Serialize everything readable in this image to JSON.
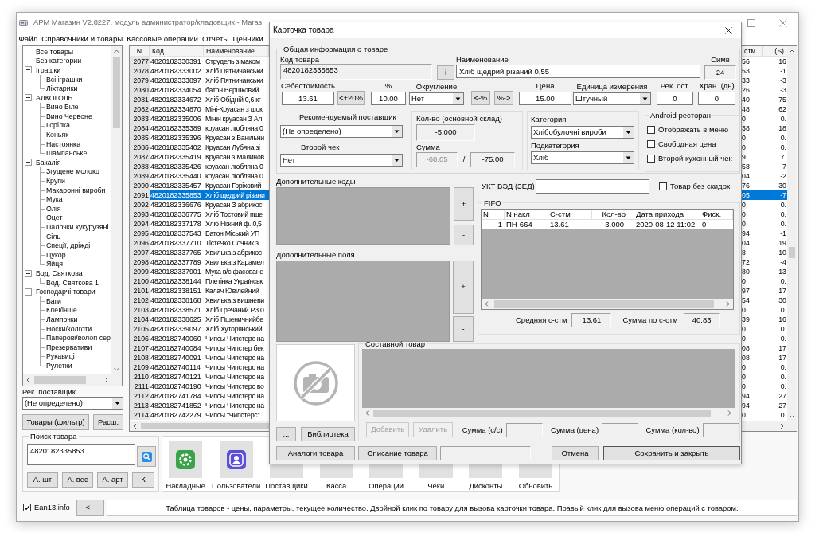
{
  "window": {
    "title": "АРМ Магазин V2.8227, модуль администратор/кладовщик - Магаз"
  },
  "menu": [
    "Файл",
    "Справочники и товары",
    "Кассовые операции",
    "Отчеты",
    "Ценники"
  ],
  "category_tree": [
    {
      "label": "Все товары"
    },
    {
      "label": "Без категории"
    },
    {
      "label": "Іграшки",
      "expanded": true,
      "children": [
        {
          "label": "Всі іграшки"
        },
        {
          "label": "Ліхтарики"
        }
      ]
    },
    {
      "label": "АЛКОГОЛЬ",
      "expanded": true,
      "children": [
        {
          "label": "Вино Біле"
        },
        {
          "label": "Вино Червоне"
        },
        {
          "label": "Горілка"
        },
        {
          "label": "Коньяк"
        },
        {
          "label": "Настоянка"
        },
        {
          "label": "Шампанське"
        }
      ]
    },
    {
      "label": "Бакалія",
      "expanded": true,
      "children": [
        {
          "label": "Згущене молоко"
        },
        {
          "label": "Крупи"
        },
        {
          "label": "Макаронні вироби"
        },
        {
          "label": "Мука"
        },
        {
          "label": "Олія"
        },
        {
          "label": "Оцет"
        },
        {
          "label": "Палочки кукурузяні"
        },
        {
          "label": "Сіль"
        },
        {
          "label": "Спеції, дріжді"
        },
        {
          "label": "Цукор"
        },
        {
          "label": "Яйця"
        }
      ]
    },
    {
      "label": "Вод. Святкова",
      "expanded": true,
      "children": [
        {
          "label": "Вод. Святкова 1"
        }
      ]
    },
    {
      "label": "Господарчі товари",
      "expanded": true,
      "children": [
        {
          "label": "Ваги"
        },
        {
          "label": "Клеї/інше"
        },
        {
          "label": "Лампочки"
        },
        {
          "label": "Носки/колготи"
        },
        {
          "label": "Паперові/вологі сер"
        },
        {
          "label": "Презервативи"
        },
        {
          "label": "Рукавиці"
        },
        {
          "label": "Рулетки"
        }
      ]
    }
  ],
  "supplier_filter": {
    "label": "Рек. поставщик",
    "value": "(Не определено)"
  },
  "filter_buttons": [
    "Товары (фильтр)",
    "Расш."
  ],
  "products_table": {
    "columns": [
      "N",
      "Код",
      "Наименование",
      "стм",
      "(S)"
    ],
    "rows": [
      {
        "cells": [
          "2077",
          "4820182330391",
          "Струдель з маком",
          "56",
          "16"
        ],
        "selected": false
      },
      {
        "cells": [
          "2078",
          "4820182333002",
          "Хліб Пятничанськи",
          "53",
          "-1"
        ],
        "selected": false
      },
      {
        "cells": [
          "2079",
          "4820182333897",
          "Хліб Пятничанськи",
          "33",
          "-3"
        ],
        "selected": false
      },
      {
        "cells": [
          "2080",
          "4820182334054",
          "батон Вершковий",
          "26",
          "-3"
        ],
        "selected": false
      },
      {
        "cells": [
          "2081",
          "4820182334672",
          "Хліб Обідній 0,6 кг",
          "40",
          "75"
        ],
        "selected": false
      },
      {
        "cells": [
          "2082",
          "4820182334870",
          "Міні-Круасан з шок",
          "48",
          "62"
        ],
        "selected": false
      },
      {
        "cells": [
          "2083",
          "4820182335006",
          "Мінін круасан З Ал",
          "0",
          "0."
        ],
        "selected": false
      },
      {
        "cells": [
          "2084",
          "4820182335389",
          "круасан любляна 0",
          "38",
          "18"
        ],
        "selected": false
      },
      {
        "cells": [
          "2085",
          "4820182335396",
          "Круасан з Ванільни",
          "0",
          "0."
        ],
        "selected": false
      },
      {
        "cells": [
          "2086",
          "4820182335402",
          "Круасан Лубяна зі",
          "0",
          "0."
        ],
        "selected": false
      },
      {
        "cells": [
          "2087",
          "4820182335419",
          "Круасан з Малинов",
          "9",
          "7."
        ],
        "selected": false
      },
      {
        "cells": [
          "2088",
          "4820182335426",
          "круасан любляна 0",
          "58",
          "-7"
        ],
        "selected": false
      },
      {
        "cells": [
          "2089",
          "4820182335440",
          "круасан любляна 0",
          "04",
          "-2"
        ],
        "selected": false
      },
      {
        "cells": [
          "2090",
          "4820182335457",
          "Круасан Горіховий",
          "76",
          "30"
        ],
        "selected": false
      },
      {
        "cells": [
          "2091",
          "4820182335853",
          "Хліб щедрий різани",
          "05",
          "-7"
        ],
        "selected": true
      },
      {
        "cells": [
          "2092",
          "4820182336676",
          "Круасан З абрикос",
          "0",
          "0."
        ],
        "selected": false
      },
      {
        "cells": [
          "2093",
          "4820182336775",
          "Хліб Тостовий пше",
          "0",
          "0."
        ],
        "selected": false
      },
      {
        "cells": [
          "2094",
          "4820182337178",
          "Хліб Ніжний ф. 0,5",
          "0",
          "0."
        ],
        "selected": false
      },
      {
        "cells": [
          "2095",
          "4820182337543",
          "Батон Міський УП",
          "94",
          "-1"
        ],
        "selected": false
      },
      {
        "cells": [
          "2096",
          "4820182337710",
          "Тістечко Сочник з",
          "04",
          "19"
        ],
        "selected": false
      },
      {
        "cells": [
          "2097",
          "4820182337765",
          "Хвилька з абрикос",
          "8",
          "10"
        ],
        "selected": false
      },
      {
        "cells": [
          "2098",
          "4820182337789",
          "Хвилька з Карамел",
          "72",
          "-4"
        ],
        "selected": false
      },
      {
        "cells": [
          "2099",
          "4820182337901",
          "Мука в/с фасоване",
          "80",
          "13"
        ],
        "selected": false
      },
      {
        "cells": [
          "2100",
          "4820182338144",
          "Плетінка Українськ",
          "0",
          "0."
        ],
        "selected": false
      },
      {
        "cells": [
          "2101",
          "4820182338151",
          "Калач Ювілейний",
          "97",
          "17"
        ],
        "selected": false
      },
      {
        "cells": [
          "2102",
          "4820182338168",
          "Хвилька з вишневи",
          "54",
          "30"
        ],
        "selected": false
      },
      {
        "cells": [
          "2103",
          "4820182338571",
          "Хліб Гречаний Р3 0",
          "0",
          "0."
        ],
        "selected": false
      },
      {
        "cells": [
          "2104",
          "4820182338625",
          "Хліб Пшеничнийбе",
          "39",
          "16"
        ],
        "selected": false
      },
      {
        "cells": [
          "2105",
          "4820182339097",
          "Хліб Хуторянський",
          "0",
          "0."
        ],
        "selected": false
      },
      {
        "cells": [
          "2106",
          "4820182740060",
          "Чипсы Чипстерс на",
          "0",
          "0."
        ],
        "selected": false
      },
      {
        "cells": [
          "2107",
          "4820182740084",
          "Чипсы Чипстер бек",
          "08",
          "17"
        ],
        "selected": false
      },
      {
        "cells": [
          "2108",
          "4820182740091",
          "Чипсы Чипстерс на",
          "08",
          "17"
        ],
        "selected": false
      },
      {
        "cells": [
          "2109",
          "4820182740114",
          "Чипсы Чипстерс на",
          "0",
          "0."
        ],
        "selected": false
      },
      {
        "cells": [
          "2110",
          "4820182740121",
          "Чипсы Чипстерс на",
          "0",
          "0."
        ],
        "selected": false
      },
      {
        "cells": [
          "2111",
          "4820182740190",
          "Чипсы Чипстерс во",
          "0",
          "0."
        ],
        "selected": false
      },
      {
        "cells": [
          "2112",
          "4820182741784",
          "Чипсы Чипстерс на",
          "94",
          "27"
        ],
        "selected": false
      },
      {
        "cells": [
          "2113",
          "4820182741852",
          "Чипсы Чипстерс на",
          "94",
          "27"
        ],
        "selected": false
      },
      {
        "cells": [
          "2114",
          "4820182742279",
          "Чипсы \"Чипстерс\"",
          "0",
          "0."
        ],
        "selected": false
      }
    ]
  },
  "product_search": {
    "title": "Поиск товара",
    "value": "4820182335853",
    "buttons": [
      "А. шт",
      "А. вес",
      "А. арт",
      "К"
    ]
  },
  "toolbar": [
    "Накладные",
    "Пользователи",
    "Поставщики",
    "Касса",
    "Операции",
    "Чеки",
    "Дисконты",
    "Обновить"
  ],
  "status_bar": {
    "ean13": {
      "label": "Ean13.info",
      "checked": true
    },
    "back_button": "<--",
    "hint": "Таблица товаров - цены, параметры, текущее количество. Двойной клик по товару для вызова карточки товара. Правый клик для вызова меню операций с товаром."
  },
  "product_card": {
    "title": "Карточка товара",
    "general_title": "Общая информация о товаре",
    "code": {
      "label": "Код товара",
      "value": "4820182335853"
    },
    "info_button": "i",
    "name": {
      "label": "Наименование",
      "value": "Хліб щедрий різаний 0,55"
    },
    "chars": {
      "label": "Симв",
      "value": "24"
    },
    "pricing": [
      {
        "kind": "input",
        "label": "Себестоимость",
        "value": "13.61"
      },
      {
        "kind": "button",
        "label": "<+20%"
      },
      {
        "kind": "input",
        "label": "%",
        "value": "10.00"
      },
      {
        "kind": "select",
        "label": "Округление",
        "value": "Нет"
      },
      {
        "kind": "button",
        "label": "<-%"
      },
      {
        "kind": "button",
        "label": "%->"
      },
      {
        "kind": "input",
        "label": "Цена",
        "value": "15.00"
      },
      {
        "kind": "select",
        "label": "Единица измерения",
        "value": "Штучный"
      },
      {
        "kind": "input",
        "label": "Рек. ост.",
        "value": "0"
      },
      {
        "kind": "input",
        "label": "Хран. (дн)",
        "value": "0"
      }
    ],
    "supplier": {
      "label": "Рекомендуемый поставщик",
      "value": "(Не определено)"
    },
    "second_receipt": {
      "label": "Второй чек",
      "value": "Нет"
    },
    "stock": {
      "label": "Кол-во (основной склад)",
      "value": "-5.000",
      "sum_label": "Сумма",
      "separator": "/",
      "sums": [
        {
          "value": "-68.05",
          "disabled": true
        },
        {
          "value": "-75.00",
          "disabled": false
        }
      ]
    },
    "category": {
      "label": "Категория",
      "value": "Хлібобулочні вироби"
    },
    "subcategory": {
      "label": "Подкатегория",
      "value": "Хліб"
    },
    "android": {
      "title": "Android ресторан",
      "options": [
        {
          "label": "Отображать в меню",
          "checked": false
        },
        {
          "label": "Свободная цена",
          "checked": false
        },
        {
          "label": "Второй кухонный чек",
          "checked": false
        }
      ]
    },
    "extra_codes": {
      "label": "Дополнительные коды",
      "buttons": [
        "+",
        "-"
      ]
    },
    "extra_fields": {
      "label": "Дополнительные поля",
      "buttons": [
        "+",
        "-"
      ]
    },
    "ukt_ved": {
      "label": "УКТ ВЭД (ЗЕД)"
    },
    "no_discount": {
      "label": "Товар без скидок",
      "checked": false
    },
    "fifo": {
      "title": "FIFO",
      "columns": [
        "N",
        "N накл",
        "С-стм",
        "Кол-во",
        "Дата прихода",
        "Фиск."
      ],
      "rows": [
        [
          "1",
          "ПН-664",
          "13.61",
          "3.000",
          "2020-08-12 11:02:",
          "0"
        ]
      ],
      "average": {
        "label": "Средняя с-стм",
        "value": "13.61"
      },
      "total": {
        "label": "Сумма по с-стм",
        "value": "40.83"
      }
    },
    "photo_buttons": [
      "...",
      "Библиотека"
    ],
    "composite": {
      "title": "Составной товар",
      "buttons": [
        {
          "label": "Добавить",
          "disabled": true
        },
        {
          "label": "Удалить",
          "disabled": true
        }
      ],
      "sums": [
        "Сумма (с/с)",
        "Сумма (цена)",
        "Сумма (кол-во)"
      ]
    },
    "footer_buttons": [
      "Аналоги товара",
      "Описание товара"
    ],
    "dialog_buttons": [
      "Отмена",
      "Сохранить и закрыть"
    ]
  }
}
